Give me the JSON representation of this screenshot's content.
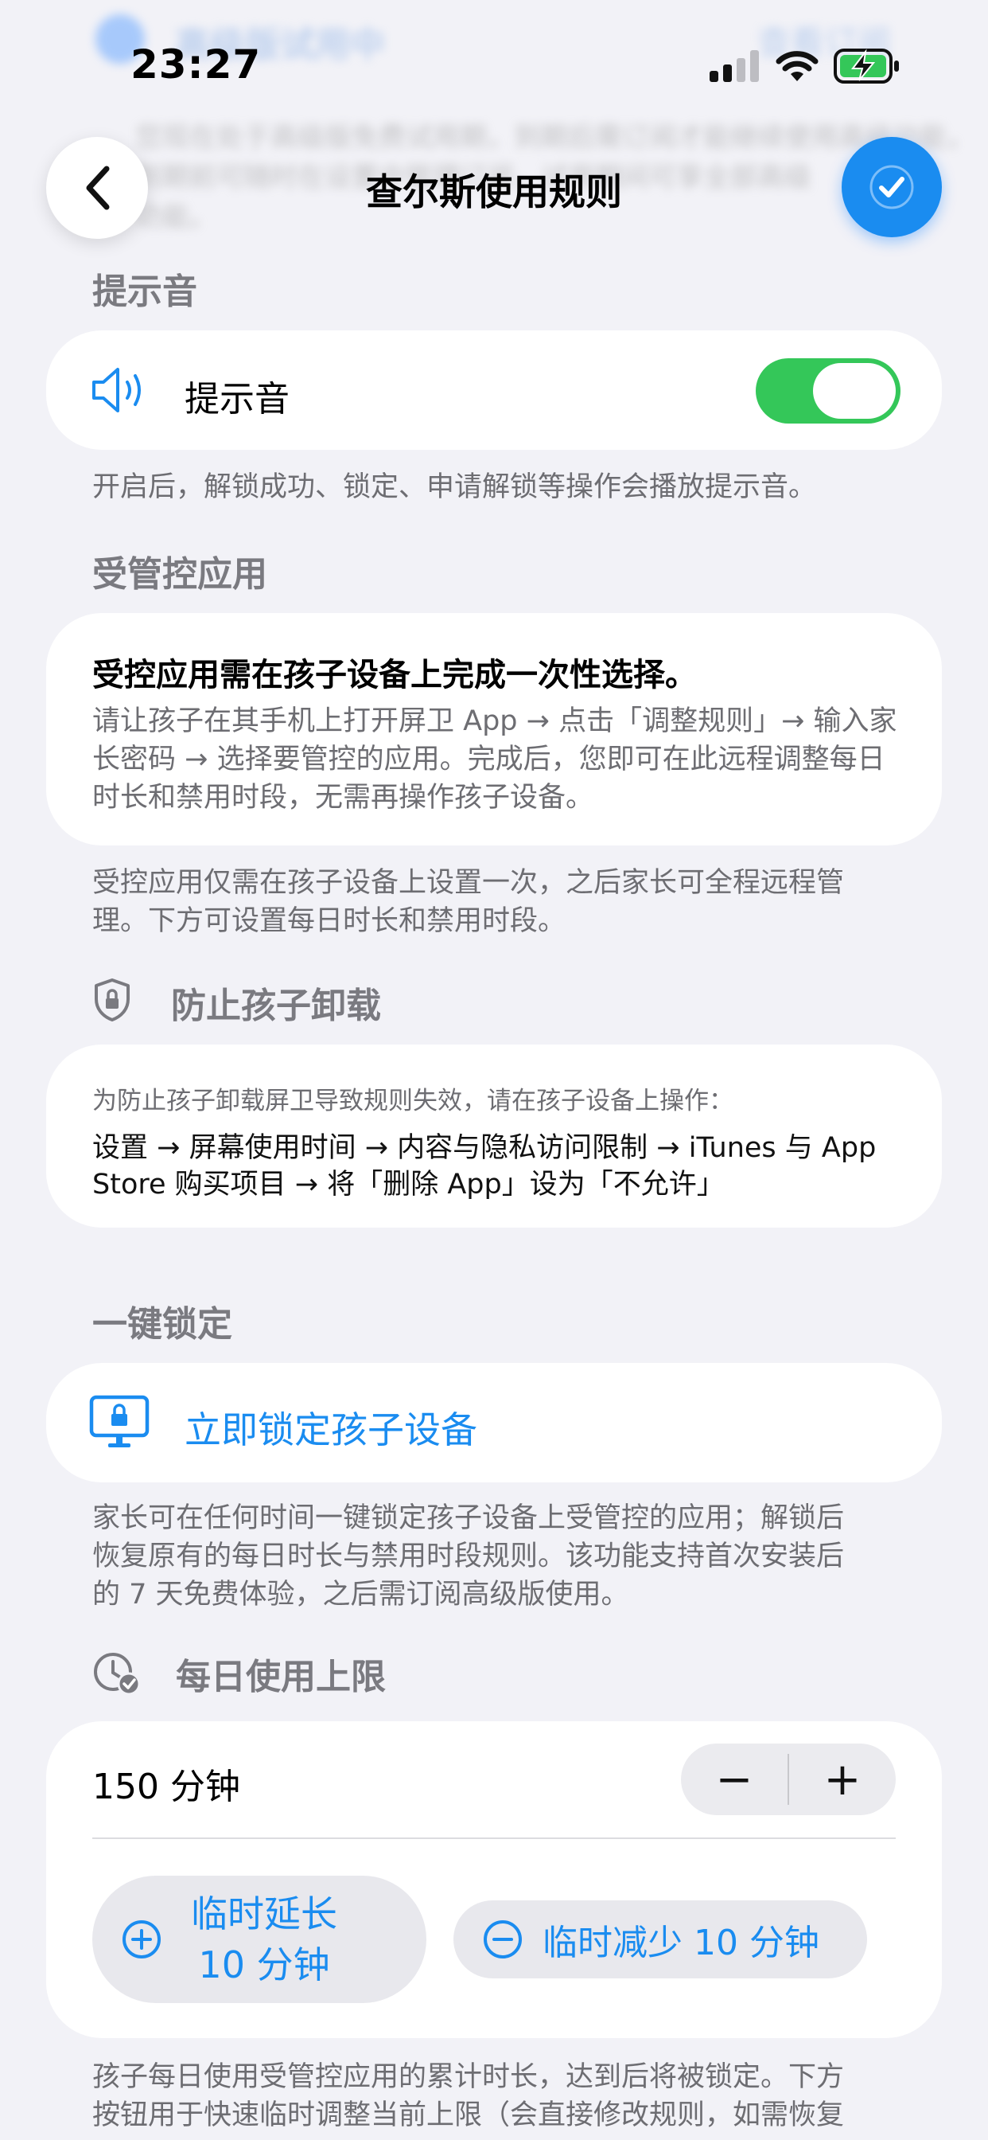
{
  "status": {
    "time": "23:27"
  },
  "background_banner": {
    "title": "高级版试用中",
    "right_link": "查看订阅",
    "line1": "您现在处于高级版免费试用期，到期后需订阅才能继续使用高级功能，",
    "line2": "到期前可随时在设置中管理订阅，试用期间可享全部高级",
    "line3": "功能。"
  },
  "nav": {
    "title": "查尔斯使用规则"
  },
  "sections": {
    "sound": {
      "header": "提示音",
      "row_label": "提示音",
      "toggle_on": true,
      "footnote": "开启后，解锁成功、锁定、申请解锁等操作会播放提示音。"
    },
    "managed_apps": {
      "header": "受管控应用",
      "card_title": "受控应用需在孩子设备上完成一次性选择。",
      "card_body_1": "请让孩子在其手机上打开屏卫 App → 点击「调整规则」→ 输入家",
      "card_body_2": "长密码 → 选择要管控的应用。完成后，您即可在此远程调整每日",
      "card_body_3": "时长和禁用时段，无需再操作孩子设备。",
      "footnote_1": "受控应用仅需在孩子设备上设置一次，之后家长可全程远程管",
      "footnote_2": "理。下方可设置每日时长和禁用时段。"
    },
    "prevent_uninstall": {
      "header": "防止孩子卸载",
      "intro": "为防止孩子卸载屏卫导致规则失效，请在孩子设备上操作：",
      "path_1": "设置 → 屏幕使用时间 → 内容与隐私访问限制 → iTunes 与 App",
      "path_2": "Store 购买项目 → 将「删除 App」设为「不允许」"
    },
    "one_tap_lock": {
      "header": "一键锁定",
      "button_label": "立即锁定孩子设备",
      "footnote_1": "家长可在任何时间一键锁定孩子设备上受管控的应用；解锁后",
      "footnote_2": "恢复原有的每日时长与禁用时段规则。该功能支持首次安装后",
      "footnote_3": "的 7 天免费体验，之后需订阅高级版使用。"
    },
    "daily_limit": {
      "header": "每日使用上限",
      "value_label": "150 分钟",
      "minus": "−",
      "plus": "+",
      "extend_line1": "临时延长",
      "extend_line2": "10 分钟",
      "reduce_label": "临时减少 10 分钟",
      "footnote_1": "孩子每日使用受管控应用的累计时长，达到后将被锁定。下方",
      "footnote_2": "按钮用于快速临时调整当前上限（会直接修改规则，如需恢复"
    }
  },
  "colors": {
    "accent": "#1a8cf0",
    "toggle_on": "#34c759",
    "background": "#f2f2f7"
  }
}
